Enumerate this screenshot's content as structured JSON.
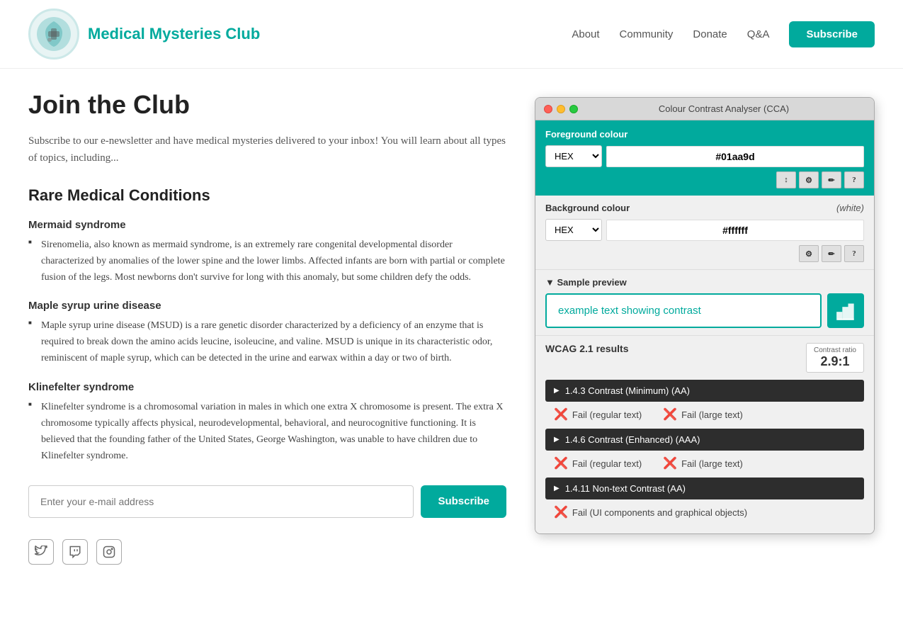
{
  "header": {
    "logo_emoji": "🏥",
    "site_title": "Medical Mysteries Club",
    "nav_items": [
      {
        "label": "About",
        "href": "#"
      },
      {
        "label": "Community",
        "href": "#"
      },
      {
        "label": "Donate",
        "href": "#"
      },
      {
        "label": "Q&A",
        "href": "#"
      }
    ],
    "subscribe_label": "Subscribe"
  },
  "main": {
    "page_heading": "Join the Club",
    "intro_text": "Subscribe to our e-newsletter and have medical mysteries delivered to your inbox! You will learn about all types of topics, including...",
    "section_heading": "Rare Medical Conditions",
    "conditions": [
      {
        "title": "Mermaid syndrome",
        "description": "Sirenomelia, also known as mermaid syndrome, is an extremely rare congenital developmental disorder characterized by anomalies of the lower spine and the lower limbs. Affected infants are born with partial or complete fusion of the legs. Most newborns don't survive for long with this anomaly, but some children defy the odds."
      },
      {
        "title": "Maple syrup urine disease",
        "description": "Maple syrup urine disease (MSUD) is a rare genetic disorder characterized by a deficiency of an enzyme that is required to break down the amino acids leucine, isoleucine, and valine. MSUD is unique in its characteristic odor, reminiscent of maple syrup, which can be detected in the urine and earwax within a day or two of birth."
      },
      {
        "title": "Klinefelter syndrome",
        "description": "Klinefelter syndrome is a chromosomal variation in males in which one extra X chromosome is present. The extra X chromosome typically affects physical, neurodevelopmental, behavioral, and neurocognitive functioning. It is believed that the founding father of the United States, George Washington, was unable to have children due to Klinefelter syndrome."
      }
    ],
    "email_placeholder": "Enter your e-mail address",
    "subscribe_btn_label": "Subscribe"
  },
  "cca_tool": {
    "title": "Colour Contrast Analyser (CCA)",
    "foreground_label": "Foreground colour",
    "fg_format": "HEX",
    "fg_value": "#01aa9d",
    "bg_label": "Background colour",
    "bg_white_note": "(white)",
    "bg_format": "HEX",
    "bg_value": "#ffffff",
    "preview_label": "Sample preview",
    "preview_text": "example text showing contrast",
    "wcag_label": "WCAG 2.1 results",
    "contrast_ratio_label": "Contrast ratio",
    "contrast_ratio_value": "2.9:1",
    "criteria": [
      {
        "label": "1.4.3 Contrast (Minimum) (AA)",
        "results": [
          {
            "label": "Fail (regular text)",
            "pass": false
          },
          {
            "label": "Fail (large text)",
            "pass": false
          }
        ]
      },
      {
        "label": "1.4.6 Contrast (Enhanced) (AAA)",
        "results": [
          {
            "label": "Fail (regular text)",
            "pass": false
          },
          {
            "label": "Fail (large text)",
            "pass": false
          }
        ]
      },
      {
        "label": "1.4.11 Non-text Contrast (AA)",
        "results": [
          {
            "label": "Fail (UI components and graphical objects)",
            "pass": false
          }
        ]
      }
    ],
    "tool_buttons_fg": [
      "↕",
      "⚙",
      "✏",
      "?"
    ],
    "tool_buttons_bg": [
      "⚙",
      "✏",
      "?"
    ]
  },
  "social": {
    "icons": [
      {
        "name": "twitter",
        "symbol": "🐦"
      },
      {
        "name": "twitch",
        "symbol": "📺"
      },
      {
        "name": "instagram",
        "symbol": "📷"
      }
    ]
  }
}
